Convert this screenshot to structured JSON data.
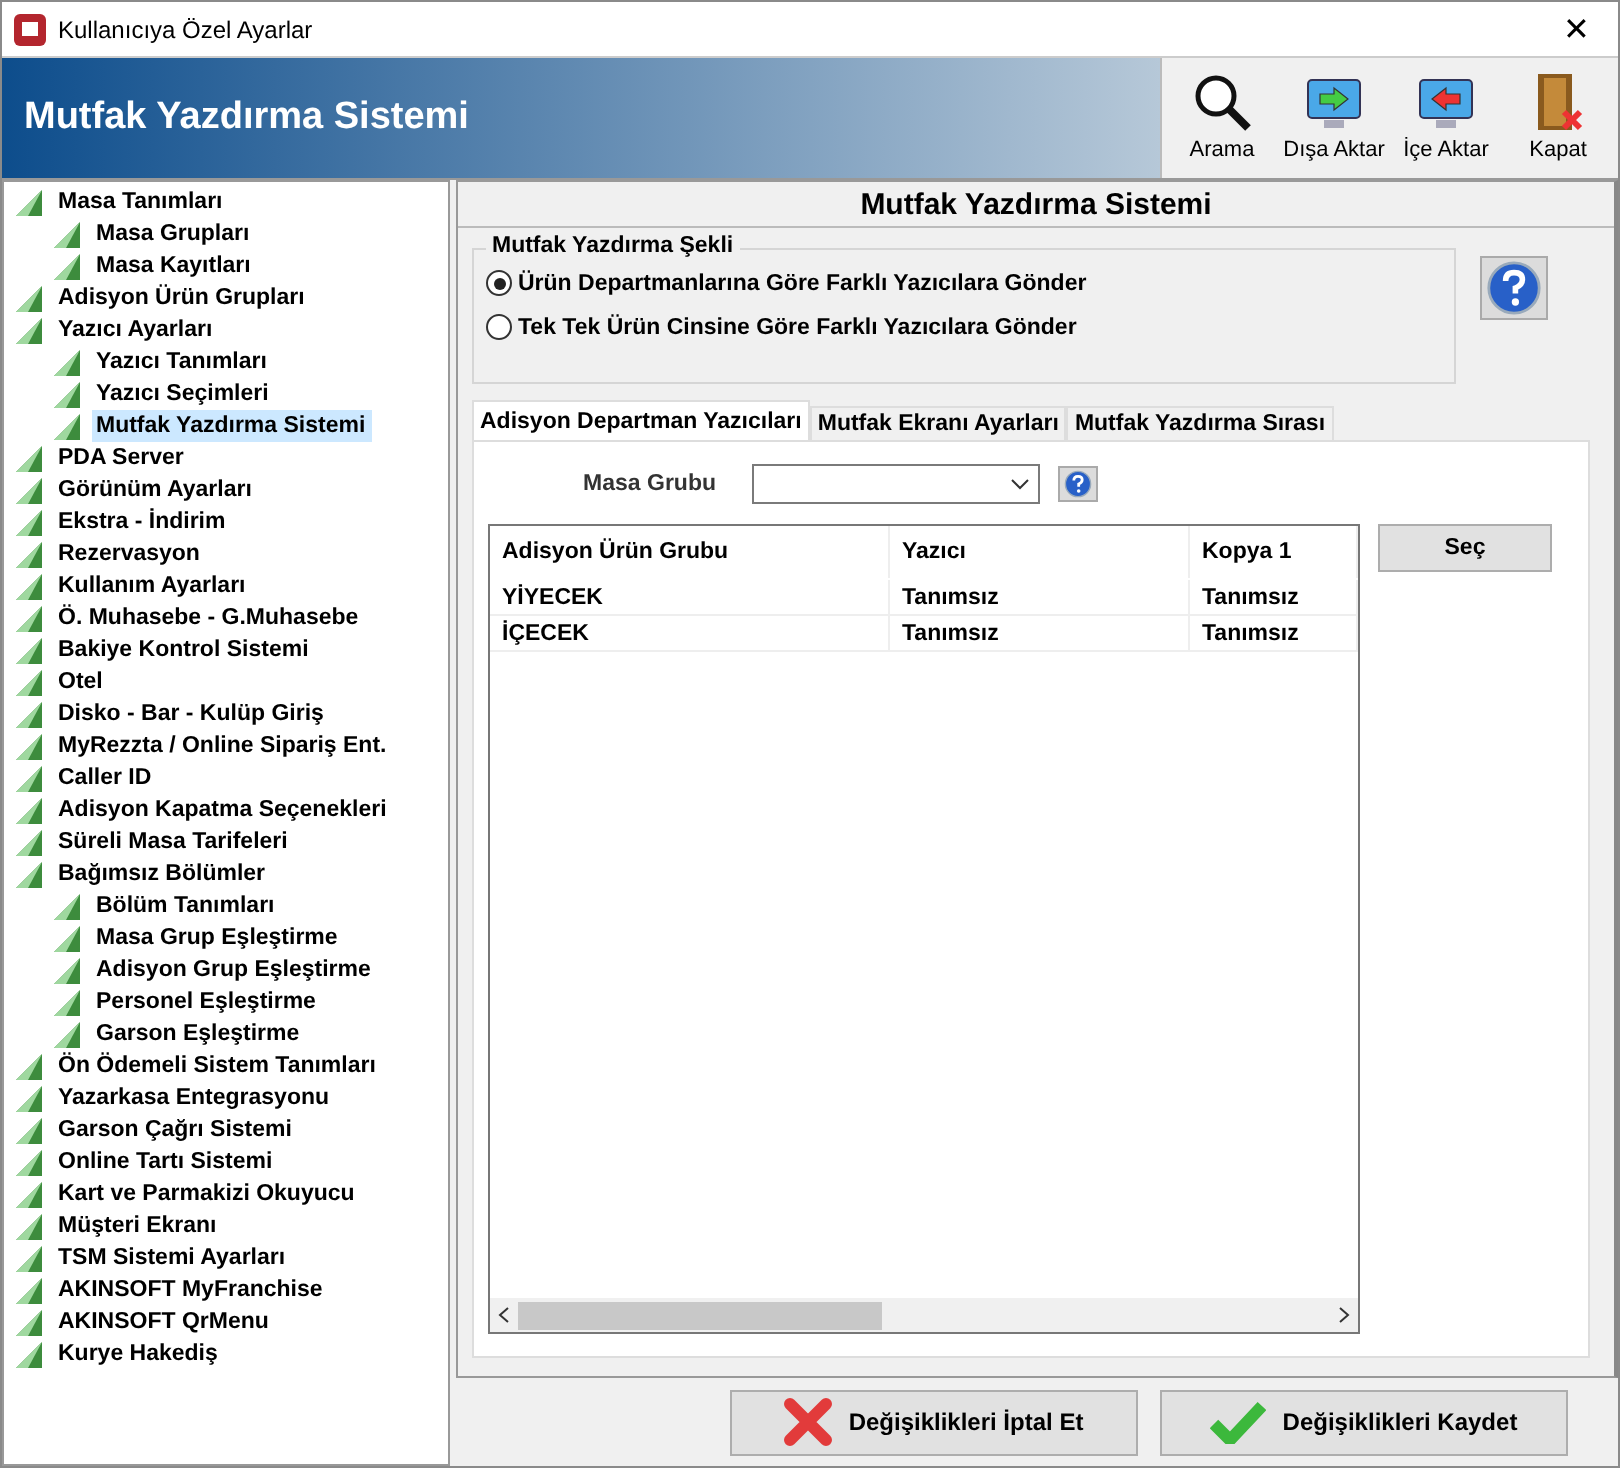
{
  "window": {
    "title": "Kullanıcıya Özel Ayarlar",
    "close": "✕"
  },
  "header": {
    "title": "Mutfak Yazdırma Sistemi"
  },
  "toolbar": [
    {
      "label": "Arama",
      "kind": "search"
    },
    {
      "label": "Dışa Aktar",
      "kind": "export"
    },
    {
      "label": "İçe Aktar",
      "kind": "import"
    },
    {
      "label": "Kapat",
      "kind": "exit"
    }
  ],
  "tree": [
    {
      "label": "Masa Tanımları",
      "selected": false,
      "children": [
        {
          "label": "Masa Grupları",
          "selected": false
        },
        {
          "label": "Masa Kayıtları",
          "selected": false
        }
      ]
    },
    {
      "label": "Adisyon Ürün Grupları",
      "selected": false
    },
    {
      "label": "Yazıcı Ayarları",
      "selected": false,
      "children": [
        {
          "label": "Yazıcı Tanımları",
          "selected": false
        },
        {
          "label": "Yazıcı Seçimleri",
          "selected": false
        },
        {
          "label": "Mutfak Yazdırma Sistemi",
          "selected": true
        }
      ]
    },
    {
      "label": "PDA Server",
      "selected": false
    },
    {
      "label": "Görünüm Ayarları",
      "selected": false
    },
    {
      "label": "Ekstra - İndirim",
      "selected": false
    },
    {
      "label": "Rezervasyon",
      "selected": false
    },
    {
      "label": "Kullanım Ayarları",
      "selected": false
    },
    {
      "label": "Ö. Muhasebe - G.Muhasebe",
      "selected": false
    },
    {
      "label": "Bakiye Kontrol Sistemi",
      "selected": false
    },
    {
      "label": "Otel",
      "selected": false
    },
    {
      "label": "Disko - Bar - Kulüp Giriş",
      "selected": false
    },
    {
      "label": "MyRezzta / Online Sipariş Ent.",
      "selected": false
    },
    {
      "label": "Caller ID",
      "selected": false
    },
    {
      "label": "Adisyon Kapatma Seçenekleri",
      "selected": false
    },
    {
      "label": "Süreli Masa Tarifeleri",
      "selected": false
    },
    {
      "label": "Bağımsız Bölümler",
      "selected": false,
      "children": [
        {
          "label": "Bölüm Tanımları",
          "selected": false
        },
        {
          "label": "Masa Grup Eşleştirme",
          "selected": false
        },
        {
          "label": "Adisyon Grup Eşleştirme",
          "selected": false
        },
        {
          "label": "Personel Eşleştirme",
          "selected": false
        },
        {
          "label": "Garson Eşleştirme",
          "selected": false
        }
      ]
    },
    {
      "label": "Ön Ödemeli Sistem Tanımları",
      "selected": false
    },
    {
      "label": "Yazarkasa Entegrasyonu",
      "selected": false
    },
    {
      "label": "Garson Çağrı Sistemi",
      "selected": false
    },
    {
      "label": "Online Tartı Sistemi",
      "selected": false
    },
    {
      "label": "Kart ve Parmakizi Okuyucu",
      "selected": false
    },
    {
      "label": "Müşteri Ekranı",
      "selected": false
    },
    {
      "label": "TSM Sistemi Ayarları",
      "selected": false
    },
    {
      "label": "AKINSOFT MyFranchise",
      "selected": false
    },
    {
      "label": "AKINSOFT QrMenu",
      "selected": false
    },
    {
      "label": "Kurye Hakediş",
      "selected": false
    }
  ],
  "panel": {
    "title": "Mutfak Yazdırma Sistemi",
    "print_mode": {
      "title": "Mutfak Yazdırma Şekli",
      "options": [
        {
          "label": "Ürün Departmanlarına Göre Farklı Yazıcılara Gönder",
          "selected": true
        },
        {
          "label": "Tek Tek Ürün Cinsine Göre Farklı Yazıcılara Gönder",
          "selected": false
        }
      ]
    },
    "tabs": [
      {
        "label": "Adisyon Departman Yazıcıları",
        "selected": true
      },
      {
        "label": "Mutfak Ekranı Ayarları",
        "selected": false
      },
      {
        "label": "Mutfak Yazdırma Sırası",
        "selected": false
      }
    ],
    "masa_grubu": {
      "label": "Masa Grubu"
    },
    "table": {
      "columns": [
        "Adisyon Ürün Grubu",
        "Yazıcı",
        "Kopya 1"
      ],
      "rows": [
        [
          "YİYECEK",
          "Tanımsız",
          "Tanımsız"
        ],
        [
          "İÇECEK",
          "Tanımsız",
          "Tanımsız"
        ]
      ]
    },
    "select_button": "Seç"
  },
  "footer": [
    {
      "label": "Değişiklikleri İptal Et",
      "kind": "cancel"
    },
    {
      "label": "Değişiklikleri Kaydet",
      "kind": "save"
    }
  ]
}
